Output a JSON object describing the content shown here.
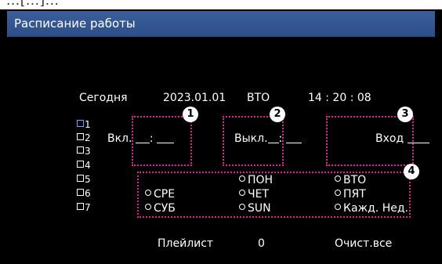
{
  "window": {
    "top_strip_text": "...[...]...",
    "title": "Расписание работы"
  },
  "today": {
    "label": "Сегодня",
    "date": "2023.01.01",
    "weekday": "ВТО",
    "time": "14 : 20 : 08"
  },
  "schedule_items": [
    "1",
    "2",
    "3",
    "4",
    "5",
    "6",
    "7"
  ],
  "on_time": {
    "label": "Вкл.",
    "separator": ":"
  },
  "off_time": {
    "label": "Выкл.",
    "separator": ":"
  },
  "input": {
    "label": "Вход"
  },
  "days": [
    {
      "label": "ПОН"
    },
    {
      "label": "ВТО"
    },
    {
      "label": "СРЕ"
    },
    {
      "label": "ЧЕТ"
    },
    {
      "label": "ПЯТ"
    },
    {
      "label": "СУБ"
    },
    {
      "label": "SUN"
    },
    {
      "label": "Кажд. Нед."
    }
  ],
  "callouts": [
    "1",
    "2",
    "3",
    "4"
  ],
  "footer": {
    "playlist_label": "Плейлист",
    "playlist_value": "0",
    "clear_all": "Очист.все"
  },
  "colors": {
    "titlebar": "#2c4e88",
    "highlight": "#d8248f",
    "selected": "#6fa0ff"
  }
}
